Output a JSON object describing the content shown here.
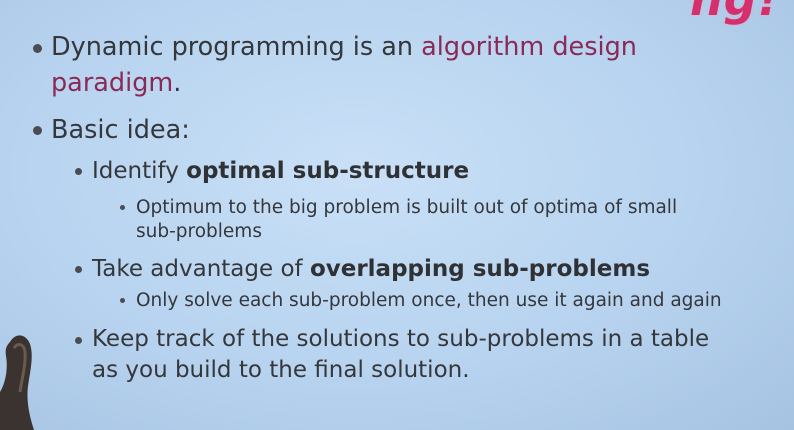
{
  "corner_fragment": "ng!",
  "bullets": {
    "b1": {
      "prefix": "Dynamic programming is an ",
      "accent_line1": "algorithm design",
      "accent_line2": "paradigm",
      "suffix": "."
    },
    "b2": {
      "text": "Basic idea:"
    },
    "b2_1": {
      "prefix": "Identify ",
      "bold": "optimal sub-structure"
    },
    "b2_1_1": {
      "line1": "Optimum to the big problem is built out of optima of small",
      "line2": "sub-problems"
    },
    "b2_2": {
      "prefix": "Take advantage of ",
      "bold": "overlapping sub-problems"
    },
    "b2_2_1": {
      "text": "Only solve each sub-problem once, then use it again and again"
    },
    "b2_3": {
      "line1": "Keep track of the solutions to sub-problems in a table",
      "line2": "as you build to the final solution."
    }
  },
  "colors": {
    "accent": "#8a2a55",
    "corner": "#d4306d",
    "background": "#b7d3ef"
  }
}
